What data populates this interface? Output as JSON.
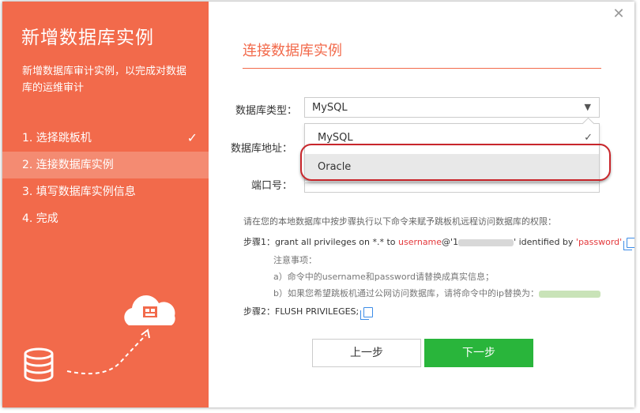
{
  "sidebar": {
    "title": "新增数据库实例",
    "description": "新增数据库审计实例，以完成对数据库的运维审计",
    "steps": [
      {
        "label": "1. 选择跳板机",
        "done": true
      },
      {
        "label": "2. 连接数据库实例",
        "active": true
      },
      {
        "label": "3. 填写数据库实例信息"
      },
      {
        "label": "4. 完成"
      }
    ]
  },
  "main": {
    "title": "连接数据库实例",
    "db_type_label": "数据库类型：",
    "db_type_value": "MySQL",
    "db_addr_label": "数据库地址：",
    "port_label": "端口号：",
    "dropdown_options": [
      "MySQL",
      "Oracle"
    ],
    "instructions": "请在您的本地数据库中按步骤执行以下命令来赋予跳板机远程访问数据库的权限：",
    "step1_prefix": "步骤1：grant all privileges on *.* to ",
    "step1_username": "username",
    "step1_mid": "@'1",
    "step1_mid2": "' identified by ",
    "step1_password": "'password'",
    "notes_title": "注意事项：",
    "note_a": "a）命令中的username和password请替换成真实信息；",
    "note_b": "b）如果您希望跳板机通过公网访问数据库，请将命令中的ip替换为：",
    "step2": "步骤2：FLUSH PRIVILEGES;",
    "prev_button": "上一步",
    "next_button": "下一步"
  },
  "colors": {
    "accent": "#f26a4b",
    "primary_button": "#29b53b",
    "highlight": "#c8262b"
  }
}
